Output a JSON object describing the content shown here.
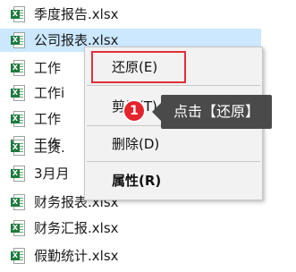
{
  "files": [
    {
      "name": "季度报告.xlsx",
      "selected": false
    },
    {
      "name": "公司报表.xlsx",
      "selected": true
    },
    {
      "name": "工作",
      "selected": false
    },
    {
      "name": "工作i",
      "selected": false
    },
    {
      "name": "工作",
      "selected": false
    },
    {
      "name": "工作",
      "selected": false
    },
    {
      "name": "工资.",
      "selected": false
    },
    {
      "name": "3月月",
      "selected": false
    },
    {
      "name": "财务报表.xlsx",
      "selected": false
    },
    {
      "name": "财务汇报.xlsx",
      "selected": false
    },
    {
      "name": "假勤统计.xlsx",
      "selected": false
    }
  ],
  "file_icon": {
    "name": "excel-file-icon",
    "badge_text": "X",
    "badge_color": "#1f7a3f"
  },
  "context_menu": {
    "items": [
      {
        "label": "还原(E)",
        "bold": false
      },
      {
        "label": "剪切(T)",
        "bold": false
      },
      {
        "label": "删除(D)",
        "bold": false
      },
      {
        "label": "属性(R)",
        "bold": true
      }
    ]
  },
  "annotation": {
    "step_number": "1",
    "callout_text": "点击【还原】",
    "highlight_color": "#e0303a",
    "badge_color": "#e4242c",
    "callout_bg": "#4a4a4a"
  },
  "colors": {
    "selection_bg": "#cce8ff",
    "menu_bg": "#f2f2f2"
  }
}
